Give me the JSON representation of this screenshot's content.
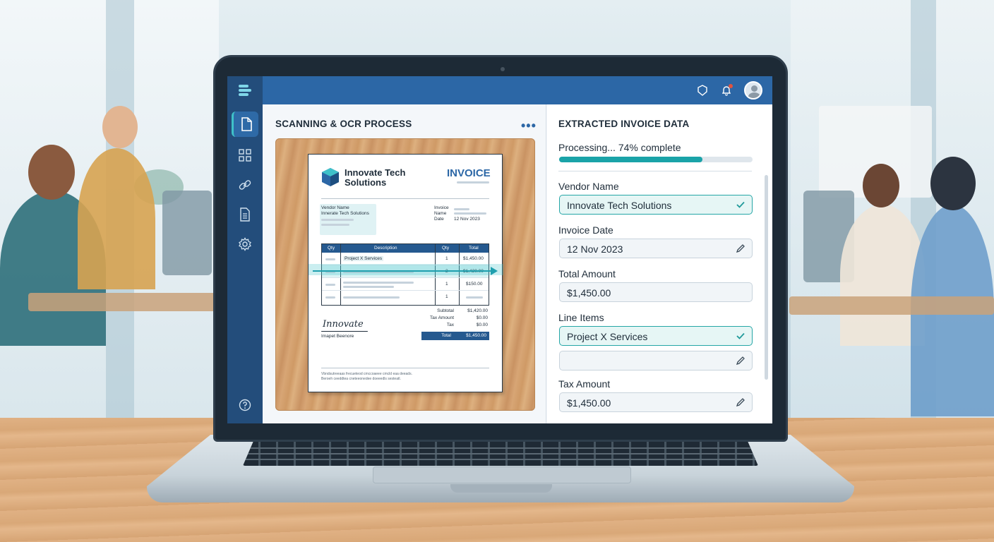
{
  "app": {
    "accent_color": "#2c67a6",
    "sidebar_color": "#234d7b",
    "success_color": "#25a6a6"
  },
  "topbar": {
    "icons": [
      "shield-icon",
      "bell-icon",
      "user-avatar"
    ]
  },
  "sidebar": {
    "items": [
      {
        "icon": "document-icon",
        "active": true
      },
      {
        "icon": "grid-icon",
        "active": false
      },
      {
        "icon": "link-icon",
        "active": false
      },
      {
        "icon": "file-list-icon",
        "active": false
      },
      {
        "icon": "settings-icon",
        "active": false
      }
    ],
    "help_icon": "help-icon"
  },
  "scan_panel": {
    "title": "SCANNING & OCR PROCESS",
    "menu_label": "•••",
    "document": {
      "company": "Innovate Tech Solutions",
      "heading": "INVOICE",
      "vendor_label": "Vendor Name",
      "vendor_value": "Innerate Tech Solutions",
      "invoice_label": "Invoice",
      "name_label": "Name",
      "date_label": "Date",
      "date_value": "12 Nov 2023",
      "table_headers": [
        "Qty",
        "Description",
        "Qty",
        "Total"
      ],
      "rows": [
        {
          "desc": "Project X Services",
          "qty": "1",
          "total": "$1,450.00"
        },
        {
          "desc": "",
          "qty": "2",
          "total": "$1,420.00"
        },
        {
          "desc": "",
          "qty": "1",
          "total": "$150.00"
        },
        {
          "desc": "",
          "qty": "1",
          "total": ""
        }
      ],
      "subtotal_label": "Subtotal",
      "subtotal_value": "$1,420.00",
      "tax_amount_label": "Tax Amount",
      "tax_amount_value": "$0.00",
      "tax_label": "Tax",
      "tax_value": "$0.00",
      "total_label": "Total",
      "total_value": "$1,450.00",
      "signature": "Innovate",
      "signer": "Imapet Beenore",
      "footer_1": "Vbndsutreeaas frecueteod cmccoaeee cmcld eaa deeads.",
      "footer_2": "Beroeh ceeddtea cneteeonedee doeeedls sesteatl."
    }
  },
  "extract_panel": {
    "title": "EXTRACTED INVOICE DATA",
    "progress_text": "Processing... 74% complete",
    "progress_fraction": 0.74,
    "fields": {
      "vendor_label": "Vendor Name",
      "vendor_value": "Innovate Tech Solutions",
      "date_label": "Invoice Date",
      "date_value": "12 Nov 2023",
      "total_label": "Total Amount",
      "total_value": "$1,450.00",
      "line_items_label": "Line Items",
      "line_item_1": "Project X Services",
      "line_item_2": "",
      "tax_label": "Tax Amount",
      "tax_value": "$1,450.00"
    }
  }
}
